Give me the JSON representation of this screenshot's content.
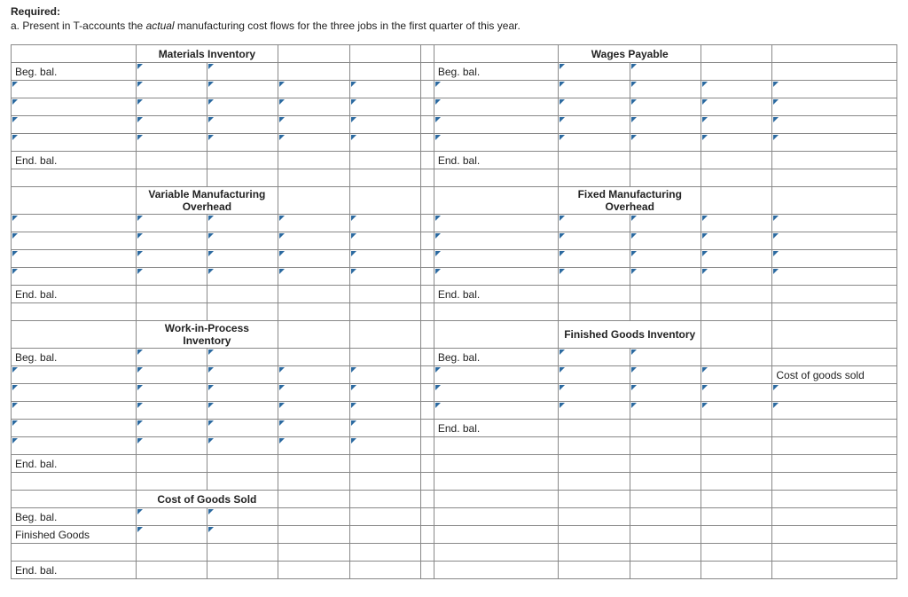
{
  "required_label": "Required:",
  "instruction_prefix": "a.",
  "instruction_text_1": "Present in T-accounts the ",
  "instruction_italic": "actual",
  "instruction_text_2": " manufacturing cost flows for the three jobs in the first quarter of this year.",
  "labels": {
    "beg_bal": "Beg. bal.",
    "end_bal": "End. bal.",
    "finished_goods": "Finished Goods",
    "cogs_right": "Cost of goods sold"
  },
  "headers": {
    "materials": "Materials Inventory",
    "wages": "Wages Payable",
    "var_oh": "Variable Manufacturing Overhead",
    "fixed_oh": "Fixed Manufacturing Overhead",
    "wip": "Work-in-Process Inventory",
    "fg": "Finished Goods Inventory",
    "cogs": "Cost of Goods Sold"
  }
}
